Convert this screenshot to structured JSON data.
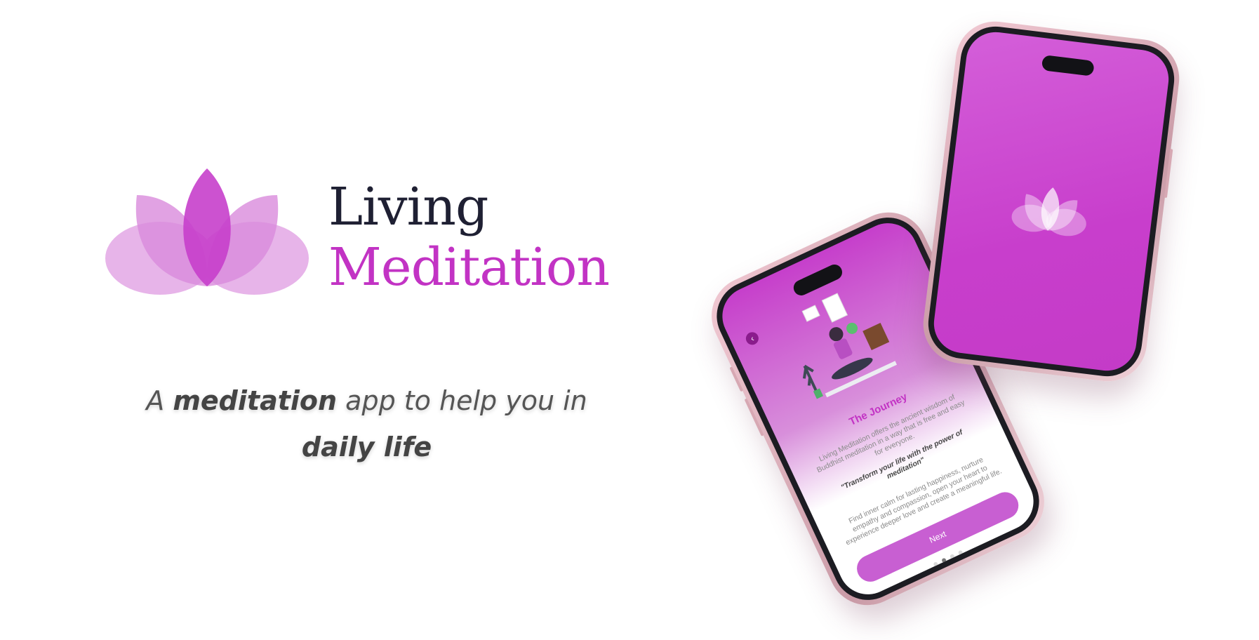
{
  "brand": {
    "line1": "Living",
    "line2": "Meditation"
  },
  "tagline": {
    "part1": "A ",
    "bold1": "meditation",
    "part2": " app to help you in",
    "bold2": "daily life"
  },
  "colors": {
    "accent": "#c233c4",
    "petal_light": "#e3a7e5",
    "petal_mid": "#d06cd3",
    "text_dark": "#1f2033",
    "text_gray": "#555555"
  },
  "onboarding": {
    "title": "The Journey",
    "body": "Living Meditation offers the ancient wisdom of Buddhist meditation in a way that is free and easy for everyone.",
    "quote": "\"Transform your life with the power of meditation\"",
    "body2": "Find inner calm for lasting happiness, nurture empathy and compassion, open your heart to experience deeper love and create a meaningful life.",
    "next_label": "Next",
    "back_icon": "chevron-left-icon",
    "page_count": 4,
    "current_page": 2
  },
  "splash": {
    "icon": "lotus-icon"
  }
}
